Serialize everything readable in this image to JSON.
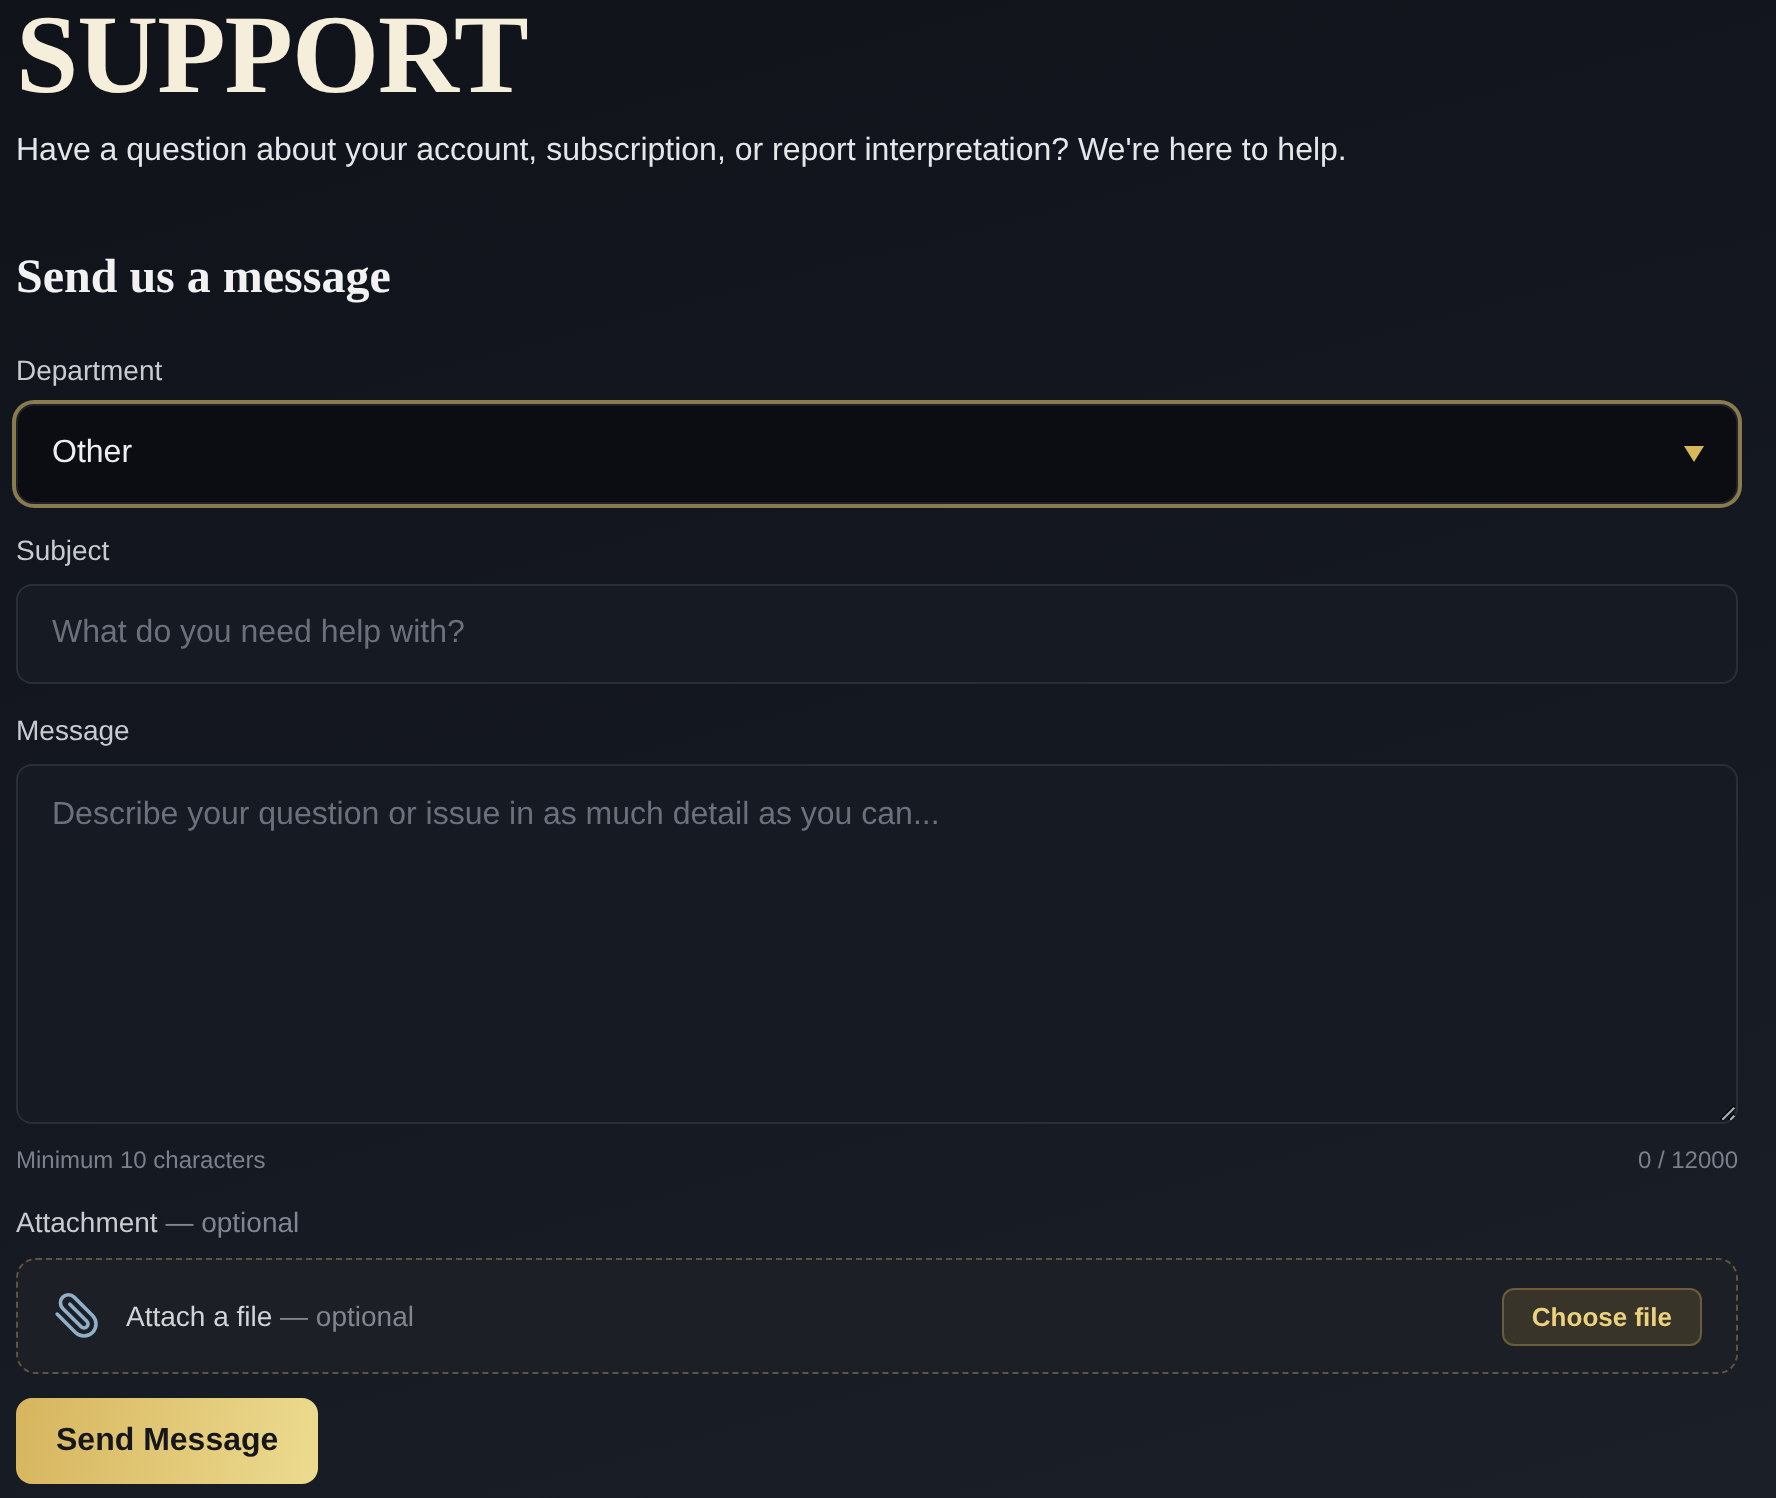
{
  "header": {
    "title": "SUPPORT",
    "subtitle": "Have a question about your account, subscription, or report interpretation? We're here to help."
  },
  "form": {
    "heading": "Send us a message",
    "fields": [
      {
        "kind": "select",
        "label": "Department",
        "value": "Other",
        "focused": true
      },
      {
        "kind": "text",
        "label": "Subject",
        "placeholder": "What do you need help with?",
        "focused": false
      },
      {
        "kind": "textarea",
        "label": "Message",
        "placeholder": "Describe your question or issue in as much detail as you can...",
        "focused": false,
        "hint": "Minimum 10 characters",
        "counter": "0 / 12000"
      }
    ],
    "attachment": {
      "label": "Attachment",
      "label_note": "— optional",
      "prompt": "Attach a file",
      "prompt_note": "— optional",
      "button": "Choose file"
    },
    "submit": "Send Message"
  }
}
